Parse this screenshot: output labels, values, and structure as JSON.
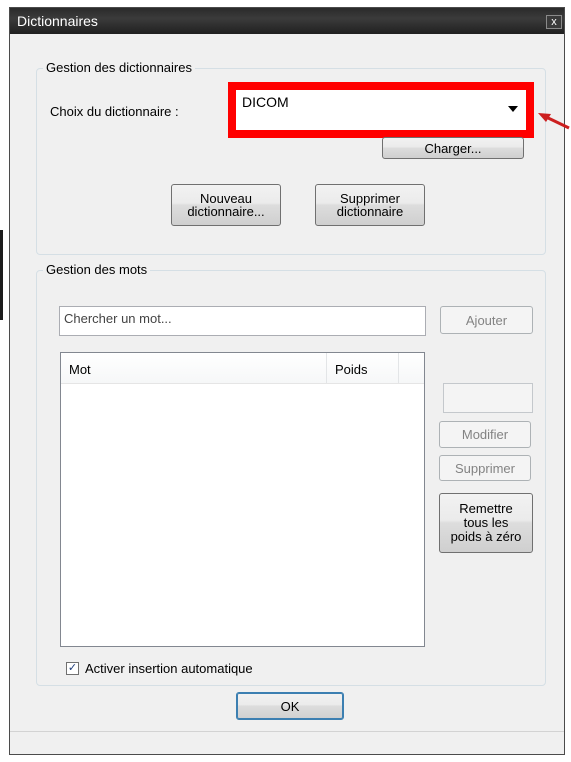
{
  "window": {
    "title": "Dictionnaires",
    "close_glyph": "x"
  },
  "dictionary_group": {
    "label": "Gestion des dictionnaires",
    "choice_label": "Choix du dictionnaire :",
    "selected": "DICOM",
    "load_button": "Charger...",
    "new_button_line1": "Nouveau",
    "new_button_line2": "dictionnaire...",
    "delete_button_line1": "Supprimer",
    "delete_button_line2": "dictionnaire"
  },
  "words_group": {
    "label": "Gestion des mots",
    "search_placeholder": "Chercher un mot...",
    "add_button": "Ajouter",
    "columns": [
      "Mot",
      "Poids"
    ],
    "modify_button": "Modifier",
    "delete_button": "Supprimer",
    "reset_line1": "Remettre",
    "reset_line2": "tous les",
    "reset_line3": "poids à zéro",
    "auto_insert_label": "Activer insertion automatique",
    "auto_insert_checked": "✓"
  },
  "ok_button": "OK",
  "colors": {
    "highlight": "#ff0000",
    "arrow": "#cc1f1f",
    "titlebar": "#2a2a2a"
  }
}
